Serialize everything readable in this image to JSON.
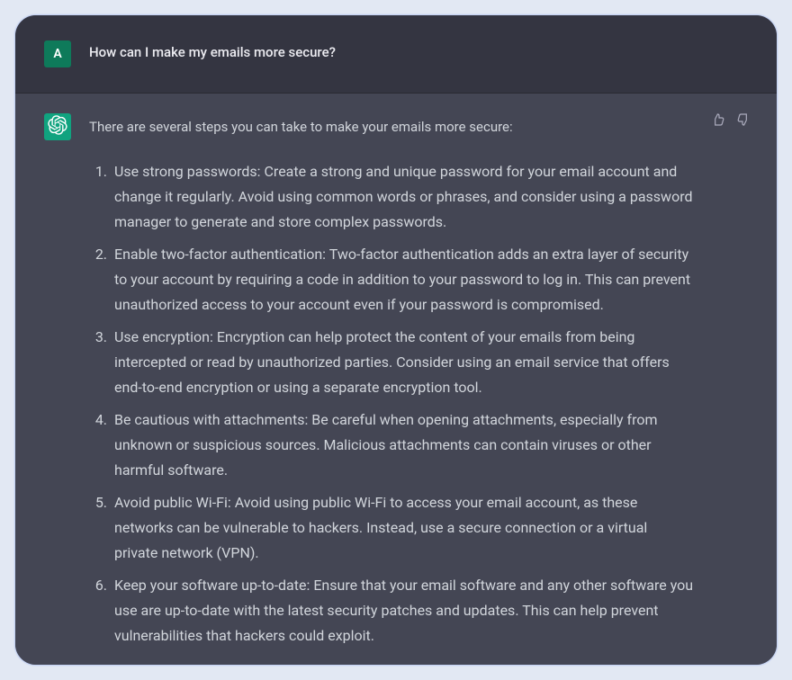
{
  "user": {
    "avatar_letter": "A",
    "message": "How can I make my emails more secure?"
  },
  "assistant": {
    "intro": "There are several steps you can take to make your emails more secure:",
    "items": [
      "Use strong passwords: Create a strong and unique password for your email account and change it regularly. Avoid using common words or phrases, and consider using a password manager to generate and store complex passwords.",
      "Enable two-factor authentication: Two-factor authentication adds an extra layer of security to your account by requiring a code in addition to your password to log in. This can prevent unauthorized access to your account even if your password is compromised.",
      "Use encryption: Encryption can help protect the content of your emails from being intercepted or read by unauthorized parties. Consider using an email service that offers end-to-end encryption or using a separate encryption tool.",
      "Be cautious with attachments: Be careful when opening attachments, especially from unknown or suspicious sources. Malicious attachments can contain viruses or other harmful software.",
      "Avoid public Wi-Fi: Avoid using public Wi-Fi to access your email account, as these networks can be vulnerable to hackers. Instead, use a secure connection or a virtual private network (VPN).",
      "Keep your software up-to-date: Ensure that your email software and any other software you use are up-to-date with the latest security patches and updates. This can help prevent vulnerabilities that hackers could exploit."
    ]
  }
}
